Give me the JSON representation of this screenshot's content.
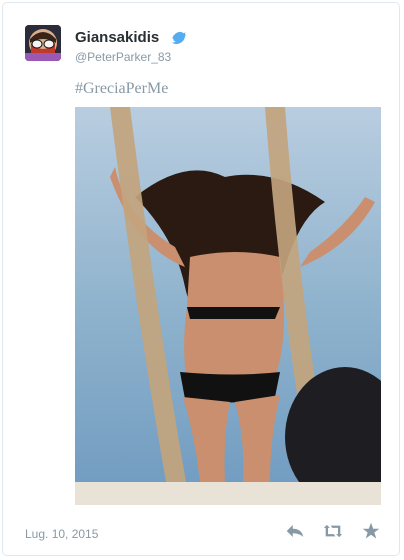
{
  "tweet": {
    "display_name": "Giansakidis",
    "handle": "@PeterParker_83",
    "text": "#GreciaPerMe",
    "timestamp": "Lug. 10, 2015",
    "verified": true
  },
  "icons": {
    "verified": "verified-badge-icon",
    "reply": "reply-icon",
    "retweet": "retweet-icon",
    "favorite": "star-icon"
  },
  "colors": {
    "name": "#292f33",
    "secondary": "#8899a6",
    "verified": "#55acee",
    "border": "#e1e8ed"
  }
}
